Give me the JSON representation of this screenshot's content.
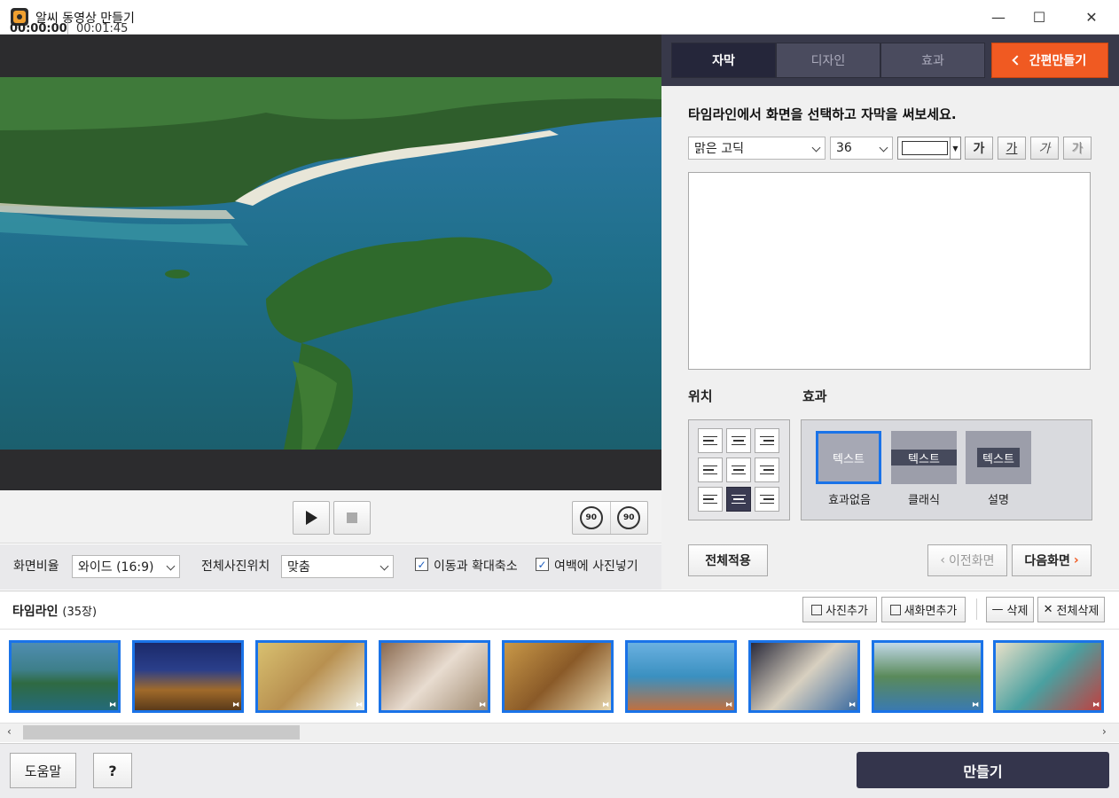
{
  "window": {
    "title": "알씨 동영상 만들기",
    "controls": {
      "minimize": "—",
      "maximize": "☐",
      "close": "✕"
    }
  },
  "player": {
    "current_time": "00:00:00",
    "total_time": "00:01:45",
    "rotate_left_label": "90",
    "rotate_right_label": "90"
  },
  "options": {
    "ratio_label": "화면비율",
    "ratio_value": "와이드 (16:9)",
    "position_label": "전체사진위치",
    "position_value": "맞춤",
    "motion_label": "이동과 확대축소",
    "motion_checked": true,
    "margin_label": "여백에 사진넣기",
    "margin_checked": true
  },
  "tabs": [
    {
      "label": "자막",
      "active": true
    },
    {
      "label": "디자인",
      "active": false
    },
    {
      "label": "효과",
      "active": false
    }
  ],
  "quick_make_label": "간편만들기",
  "caption": {
    "instruction": "타임라인에서 화면을 선택하고 자막을 써보세요.",
    "font_value": "맑은 고딕",
    "size_value": "36",
    "text_color": "#ffffff",
    "format_buttons": [
      "가",
      "가",
      "가",
      "가"
    ],
    "text_value": ""
  },
  "position_section": {
    "label": "위치",
    "selected_index": 7
  },
  "effect_section": {
    "label": "효과",
    "items": [
      {
        "preview_text": "텍스트",
        "label": "효과없음",
        "selected": true
      },
      {
        "preview_text": "텍스트",
        "label": "클래식",
        "selected": false
      },
      {
        "preview_text": "텍스트",
        "label": "설명",
        "selected": false
      }
    ]
  },
  "actions": {
    "apply_all": "전체적용",
    "prev": "이전화면",
    "next": "다음화면"
  },
  "timeline": {
    "title": "타임라인",
    "count": "(35장)",
    "add_photo": "사진추가",
    "add_blank": "새화면추가",
    "delete": "삭제",
    "delete_all": "전체삭제"
  },
  "footer": {
    "help": "도움말",
    "question": "?",
    "make": "만들기"
  },
  "colors": {
    "accent_orange": "#f05a22",
    "dark_navy": "#34354c",
    "select_blue": "#1a73e8"
  }
}
